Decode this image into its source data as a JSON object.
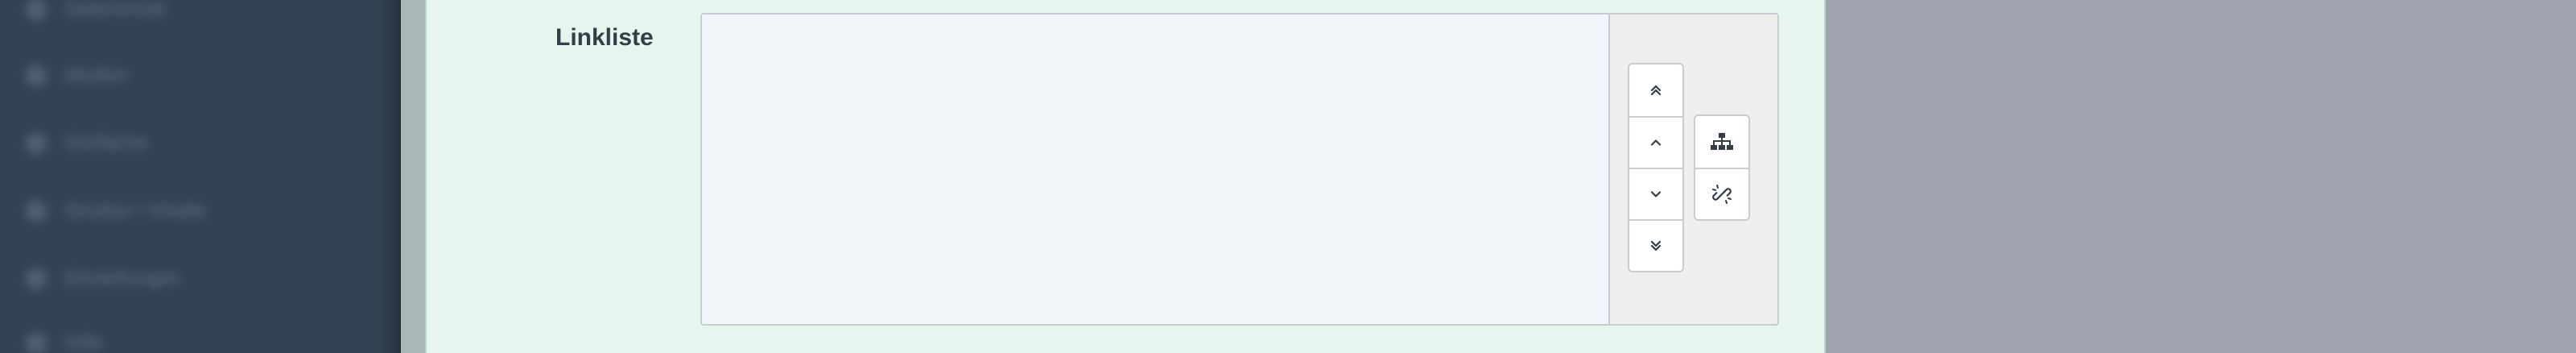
{
  "sidebar": {
    "items": [
      {
        "label": "Seiteninhalt"
      },
      {
        "label": "Medien"
      },
      {
        "label": "Sitzfläche"
      },
      {
        "label": "Struktur / Inhalte"
      },
      {
        "label": "Einstellungen"
      },
      {
        "label": "Hilfe"
      }
    ]
  },
  "form": {
    "field_label": "Linkliste",
    "linklist_items": []
  },
  "controls": {
    "move_buttons": [
      {
        "icon": "double-chevron-up-icon"
      },
      {
        "icon": "chevron-up-icon"
      },
      {
        "icon": "chevron-down-icon"
      },
      {
        "icon": "double-chevron-down-icon"
      }
    ],
    "action_buttons": [
      {
        "icon": "sitemap-icon"
      },
      {
        "icon": "unlink-icon"
      }
    ]
  },
  "colors": {
    "sidebar_bg": "#344353",
    "panel_bg": "#e6f5ee",
    "list_bg": "#f2f5fa",
    "controls_bg": "#efefef",
    "page_bg": "#9ea3ae",
    "icon": "#333e48"
  }
}
